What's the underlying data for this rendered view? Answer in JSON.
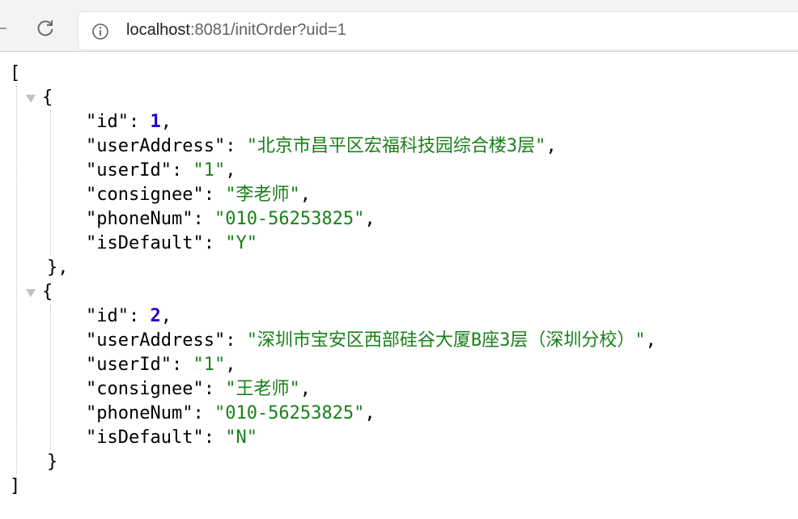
{
  "browser": {
    "url": {
      "host": "localhost",
      "rest": ":8081/initOrder?uid=1"
    },
    "icons": {
      "back": "arrow-back-icon",
      "reload": "reload-icon",
      "info": "info-icon"
    }
  },
  "json": {
    "open_bracket": "[",
    "close_bracket": "]",
    "items": [
      {
        "open": "{",
        "close": "},",
        "fields": [
          {
            "key": "\"id\"",
            "sep": ": ",
            "value": "1",
            "type": "num",
            "comma": ","
          },
          {
            "key": "\"userAddress\"",
            "sep": ": ",
            "value": "\"北京市昌平区宏福科技园综合楼3层\"",
            "type": "str",
            "comma": ","
          },
          {
            "key": "\"userId\"",
            "sep": ": ",
            "value": "\"1\"",
            "type": "str",
            "comma": ","
          },
          {
            "key": "\"consignee\"",
            "sep": ": ",
            "value": "\"李老师\"",
            "type": "str",
            "comma": ","
          },
          {
            "key": "\"phoneNum\"",
            "sep": ": ",
            "value": "\"010-56253825\"",
            "type": "str",
            "comma": ","
          },
          {
            "key": "\"isDefault\"",
            "sep": ": ",
            "value": "\"Y\"",
            "type": "str",
            "comma": ""
          }
        ]
      },
      {
        "open": "{",
        "close": "}",
        "fields": [
          {
            "key": "\"id\"",
            "sep": ": ",
            "value": "2",
            "type": "num",
            "comma": ","
          },
          {
            "key": "\"userAddress\"",
            "sep": ": ",
            "value": "\"深圳市宝安区西部硅谷大厦B座3层（深圳分校）\"",
            "type": "str",
            "comma": ","
          },
          {
            "key": "\"userId\"",
            "sep": ": ",
            "value": "\"1\"",
            "type": "str",
            "comma": ","
          },
          {
            "key": "\"consignee\"",
            "sep": ": ",
            "value": "\"王老师\"",
            "type": "str",
            "comma": ","
          },
          {
            "key": "\"phoneNum\"",
            "sep": ": ",
            "value": "\"010-56253825\"",
            "type": "str",
            "comma": ","
          },
          {
            "key": "\"isDefault\"",
            "sep": ": ",
            "value": "\"N\"",
            "type": "str",
            "comma": ""
          }
        ]
      }
    ]
  },
  "colors": {
    "string": "#1a801a",
    "number": "#1c00cf",
    "toolbar": "#f1f3f4"
  }
}
